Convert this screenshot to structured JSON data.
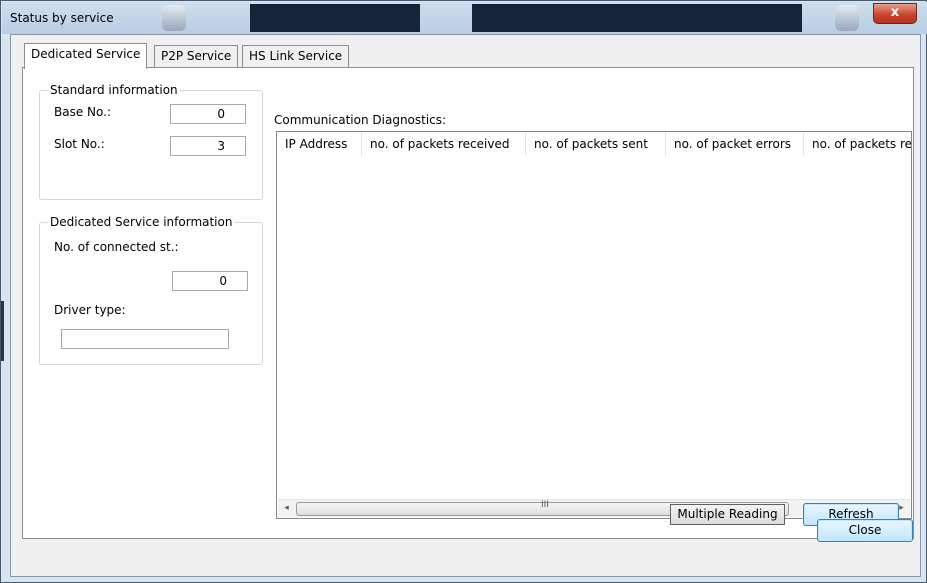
{
  "window": {
    "title": "Status by service",
    "close_glyph": "x"
  },
  "tabs": [
    {
      "label": "Dedicated Service",
      "active": true
    },
    {
      "label": "P2P Service",
      "active": false
    },
    {
      "label": "HS Link Service",
      "active": false
    }
  ],
  "standard_info": {
    "title": "Standard information",
    "base_label": "Base No.:",
    "base_value": "0",
    "slot_label": "Slot No.:",
    "slot_value": "3"
  },
  "dedicated_info": {
    "title": "Dedicated Service information",
    "connected_label": "No. of connected st.:",
    "connected_value": "0",
    "driver_label": "Driver type:",
    "driver_value": ""
  },
  "diagnostics": {
    "label": "Communication Diagnostics:",
    "columns": [
      "IP Address",
      "no. of packets received",
      "no. of packets sent",
      "no. of packet errors",
      "no. of packets re"
    ],
    "rows": [],
    "scroll_left": "◂",
    "scroll_right": "▸",
    "scroll_grip": "III"
  },
  "buttons": {
    "multiple_reading": "Multiple Reading",
    "refresh": "Refresh",
    "close": "Close"
  },
  "icons": {
    "scroll_left": "left-arrow-icon",
    "scroll_right": "right-arrow-icon"
  }
}
